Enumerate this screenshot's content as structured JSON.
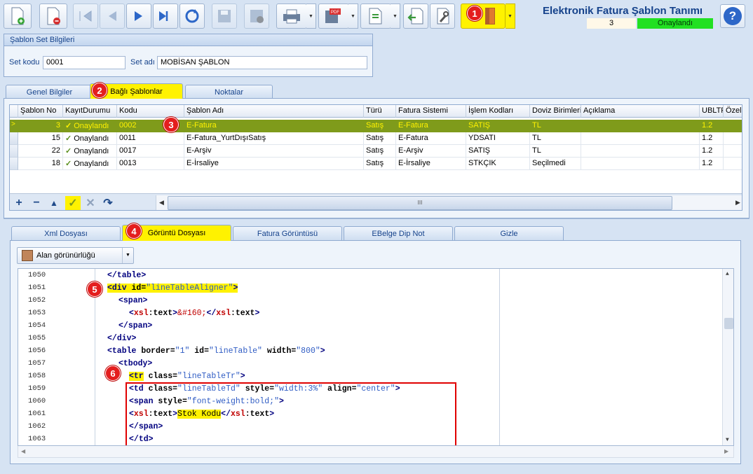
{
  "header": {
    "title": "Elektronik Fatura Şablon Tanımı",
    "record_no": "3",
    "status": "Onaylandı",
    "help": "?"
  },
  "badges": [
    "1",
    "2",
    "3",
    "4",
    "5",
    "6"
  ],
  "group": {
    "title": "Şablon Set Bilgileri",
    "set_kodu_label": "Set kodu",
    "set_kodu": "0001",
    "set_adi_label": "Set adı",
    "set_adi": "MOBİSAN ŞABLON"
  },
  "tabs_top": [
    "Genel Bilgiler",
    "Bağlı Şablonlar",
    "Noktalar"
  ],
  "grid": {
    "columns": [
      "Şablon No",
      "KayıtDurumu",
      "Kodu",
      "Şablon Adı",
      "Türü",
      "Fatura Sistemi",
      "İşlem Kodları",
      "Doviz Birimleri",
      "Açıklama",
      "UBLTR",
      "Özel F"
    ],
    "rows": [
      [
        "3",
        "Onaylandı",
        "0002",
        "E-Fatura",
        "Satış",
        "E-Fatura",
        "SATIŞ",
        "TL",
        "",
        "1.2",
        ""
      ],
      [
        "15",
        "Onaylandı",
        "0011",
        "E-Fatura_YurtDışıSatış",
        "Satış",
        "E-Fatura",
        "YDSATI",
        "TL",
        "",
        "1.2",
        ""
      ],
      [
        "22",
        "Onaylandı",
        "0017",
        "E-Arşiv",
        "Satış",
        "E-Arşiv",
        "SATIŞ",
        "TL",
        "",
        "1.2",
        ""
      ],
      [
        "18",
        "Onaylandı",
        "0013",
        "E-İrsaliye",
        "Satış",
        "E-İrsaliye",
        "STKÇIK",
        "Seçilmedi",
        "",
        "1.2",
        ""
      ]
    ],
    "scroll_mark": "III"
  },
  "tabs_bottom": [
    "Xml Dosyası",
    "Görüntü Dosyası",
    "Fatura Görüntüsü",
    "EBelge Dip Not",
    "Gizle"
  ],
  "field_visibility": "Alan görünürlüğü",
  "code": {
    "lines": [
      "1050",
      "1051",
      "1052",
      "1053",
      "1054",
      "1055",
      "1056",
      "1057",
      "1058",
      "1059",
      "1060",
      "1061",
      "1062",
      "1063"
    ],
    "t": {
      "lt": "<",
      "gt": ">",
      "lts": "</",
      "q": "\"",
      "sp": " ",
      "eq": "=",
      "col": ":",
      "table": "table",
      "div": "div",
      "id": "id",
      "span": "span",
      "xsl": "xsl",
      "text": "text",
      "border": "border",
      "width": "width",
      "tbody": "tbody",
      "tr": "tr",
      "td": "td",
      "class": "class",
      "style": "style",
      "align": "align",
      "v_aligner": "lineTableAligner",
      "nbsp": "&#160;",
      "v_one": "1",
      "v_linetable": "lineTable",
      "v_800": "800",
      "v_tr": "lineTableTr",
      "v_td": "lineTableTd",
      "v_w3": "width:3%",
      "v_center": "center",
      "v_bold": "font-weight:bold;",
      "stok": "Stok Kodu"
    }
  },
  "colors": {
    "accent": "#fff200",
    "selected_row": "#7f9b1b",
    "status_ok": "#22e022",
    "badge": "#e41e1e",
    "highlight_box": "#e00000"
  }
}
